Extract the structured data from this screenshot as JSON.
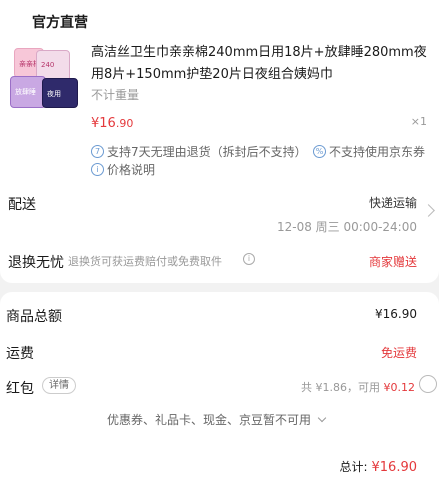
{
  "shop": {
    "name": "官方直营"
  },
  "product": {
    "title": "高洁丝卫生巾亲亲棉240mm日用18片+放肆睡280mm夜用8片+150mm护垫20片日夜组合姨妈巾",
    "weight": "不计重量",
    "price_symbol": "¥",
    "price_int": "16",
    "price_dec": ".90",
    "quantity": "×1",
    "pkg_labels": [
      "亲亲棉",
      "夜用",
      "放肆睡",
      "240"
    ]
  },
  "promises": {
    "return_icon": "7",
    "return_text": "支持7天无理由退货（拆封后不支持）",
    "card_icon": "%",
    "card_text": "不支持使用京东券",
    "price_icon": "i",
    "price_text": "价格说明"
  },
  "delivery": {
    "label": "配送",
    "method": "快递运输",
    "time": "12-08 周三 00:00-24:00"
  },
  "worry_free": {
    "label": "退换无忧",
    "desc": "退换货可获运费赔付或免费取件",
    "gift": "商家赠送"
  },
  "summary": {
    "goods_total_label": "商品总额",
    "goods_total_value": "¥16.90",
    "shipping_label": "运费",
    "shipping_value": "免运费",
    "red_packet_label": "红包",
    "detail_label": "详情",
    "red_packet_total": "共 ¥1.86，可用",
    "red_packet_usable": "¥0.12",
    "notice": "优惠券、礼品卡、现金、京豆暂不可用",
    "grand_total_label": "总计:",
    "grand_total_value": "¥16.90"
  },
  "colors": {
    "accent": "#e4393c",
    "muted": "#999999",
    "background": "#f2f2f2",
    "icon_blue": "#6c9bd2"
  },
  "icons": [
    "seven-day-return-icon",
    "coupon-icon",
    "info-icon",
    "chevron-right-icon",
    "chevron-down-icon",
    "radio-icon"
  ]
}
